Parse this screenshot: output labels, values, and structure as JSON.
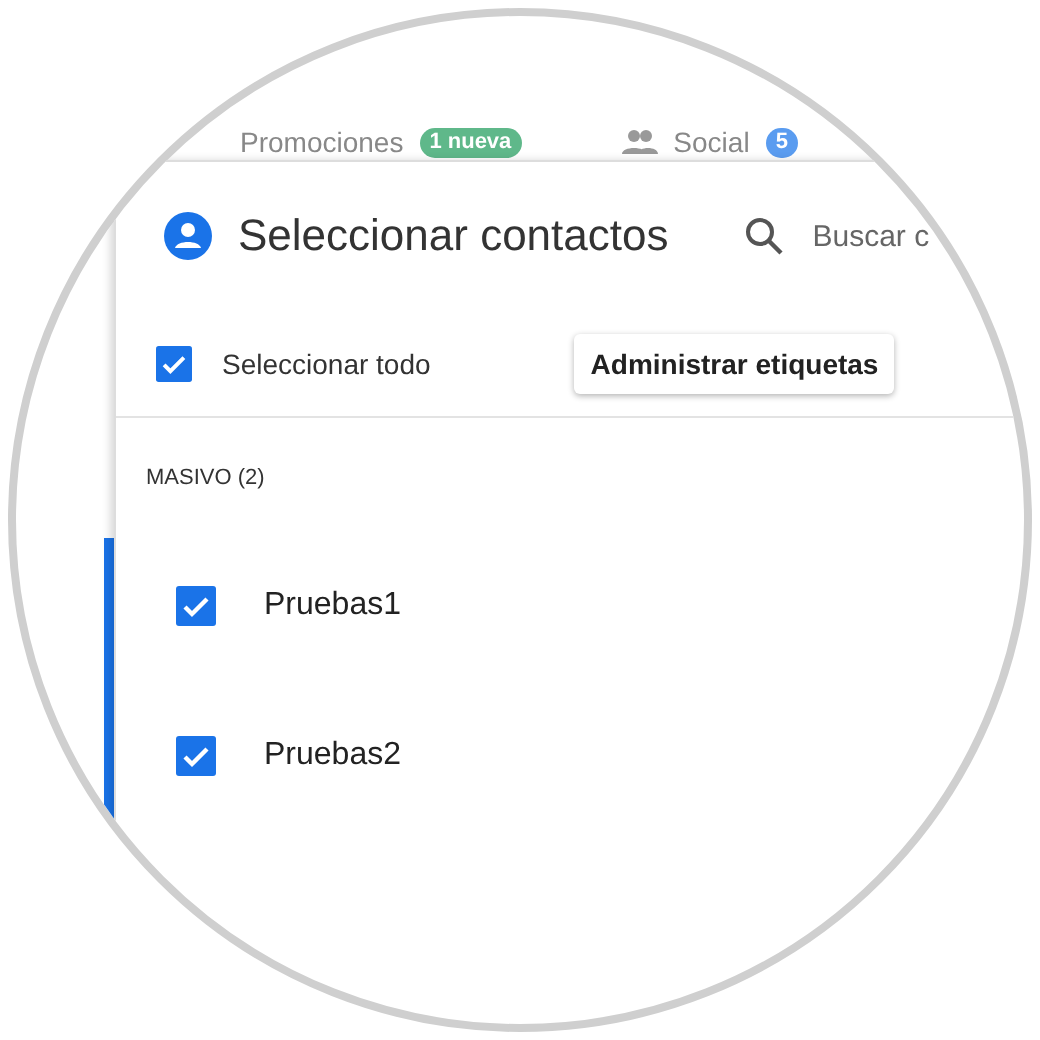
{
  "background_tabs": [
    {
      "kind": "promotions",
      "label": "Promociones",
      "badge": "1 nueva",
      "color": "#5fb88a"
    },
    {
      "kind": "social",
      "label": "Social",
      "badge": "5",
      "color": "#5a9cf0"
    }
  ],
  "dialog": {
    "title": "Seleccionar contactos",
    "search": {
      "placeholder": "Buscar c"
    },
    "select_all": {
      "label": "Seleccionar todo",
      "checked": true
    },
    "manage_button": "Administrar etiquetas",
    "group": {
      "label": "MASIVO (2)",
      "contacts": [
        {
          "name": "Pruebas1",
          "checked": true
        },
        {
          "name": "Pruebas2",
          "checked": true
        }
      ]
    }
  }
}
